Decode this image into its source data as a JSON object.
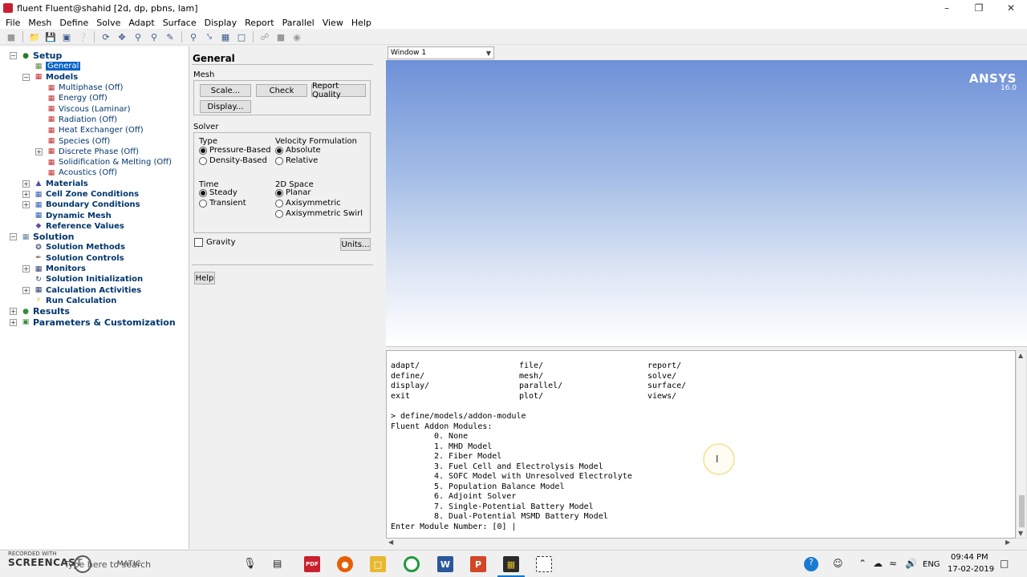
{
  "window": {
    "title": "fluent Fluent@shahid [2d, dp, pbns, lam]"
  },
  "menu": [
    "File",
    "Mesh",
    "Define",
    "Solve",
    "Adapt",
    "Surface",
    "Display",
    "Report",
    "Parallel",
    "View",
    "Help"
  ],
  "tree": {
    "setup": "Setup",
    "general": "General",
    "models": "Models",
    "model_items": [
      "Multiphase (Off)",
      "Energy (Off)",
      "Viscous (Laminar)",
      "Radiation (Off)",
      "Heat Exchanger (Off)",
      "Species (Off)",
      "Discrete Phase (Off)",
      "Solidification & Melting (Off)",
      "Acoustics (Off)"
    ],
    "materials": "Materials",
    "cell_zone": "Cell Zone Conditions",
    "boundary": "Boundary Conditions",
    "dynamic_mesh": "Dynamic Mesh",
    "reference": "Reference Values",
    "solution": "Solution",
    "solution_items": [
      "Solution Methods",
      "Solution Controls",
      "Monitors",
      "Solution Initialization",
      "Calculation Activities",
      "Run Calculation"
    ],
    "results": "Results",
    "params": "Parameters & Customization"
  },
  "panel": {
    "title": "General",
    "mesh_label": "Mesh",
    "scale_btn": "Scale...",
    "check_btn": "Check",
    "report_quality_btn": "Report Quality",
    "display_btn": "Display...",
    "solver_label": "Solver",
    "type_label": "Type",
    "pressure_based": "Pressure-Based",
    "density_based": "Density-Based",
    "velocity_label": "Velocity Formulation",
    "absolute": "Absolute",
    "relative": "Relative",
    "time_label": "Time",
    "steady": "Steady",
    "transient": "Transient",
    "space_label": "2D Space",
    "planar": "Planar",
    "axisymmetric": "Axisymmetric",
    "axisym_swirl": "Axisymmetric Swirl",
    "gravity": "Gravity",
    "units_btn": "Units...",
    "help_btn": "Help"
  },
  "graphics": {
    "window_select": "Window 1",
    "logo": "ANSYS",
    "version": "16.0"
  },
  "console": {
    "command_cols": [
      [
        "adapt/",
        "define/",
        "display/",
        "exit"
      ],
      [
        "file/",
        "mesh/",
        "parallel/",
        "plot/"
      ],
      [
        "report/",
        "solve/",
        "surface/",
        "views/"
      ]
    ],
    "prompt": "> define/models/addon-module",
    "header": "Fluent Addon Modules:",
    "modules": [
      "0. None",
      "1. MHD Model",
      "2. Fiber Model",
      "3. Fuel Cell and Electrolysis Model",
      "4. SOFC Model with Unresolved Electrolyte",
      "5. Population Balance Model",
      "6. Adjoint Solver",
      "7. Single-Potential Battery Model",
      "8. Dual-Potential MSMD Battery Model"
    ],
    "input_line": "Enter Module Number: [0] |"
  },
  "taskbar": {
    "watermark_small": "RECORDED WITH",
    "watermark_big": "SCREENCAST",
    "watermark_suffix": "MATIC",
    "search_text": "Type here to search",
    "lang": "ENG",
    "time": "09:44 PM",
    "date": "17-02-2019",
    "pdf_label": "PDF",
    "word_label": "W",
    "ppt_label": "P"
  }
}
